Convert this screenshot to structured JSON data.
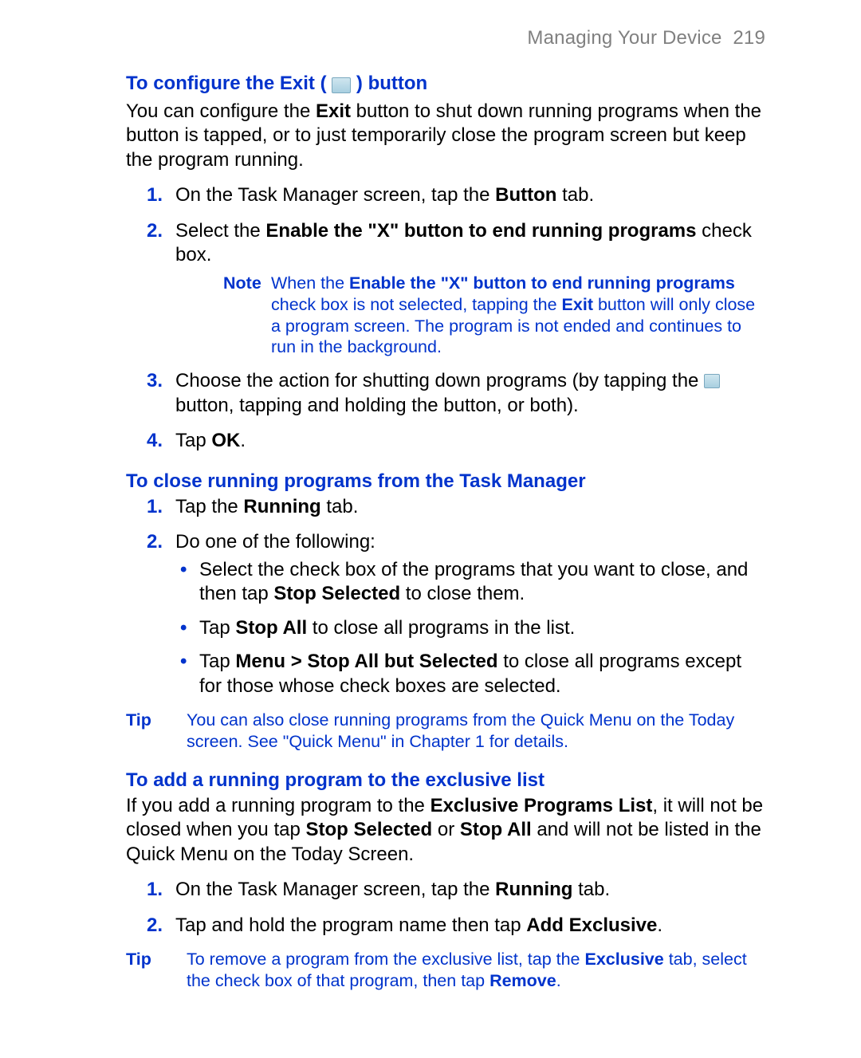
{
  "header": {
    "chapter": "Managing Your Device",
    "page_number": "219"
  },
  "sec1": {
    "title_a": "To configure the Exit (",
    "title_b": ") button",
    "intro_a": "You can configure the ",
    "intro_exit": "Exit",
    "intro_b": " button to shut down running programs when the button is tapped, or to just temporarily close the program screen but keep the program running.",
    "step1_a": "On the Task Manager screen, tap the ",
    "step1_button": "Button",
    "step1_b": " tab.",
    "step2_a": "Select the ",
    "step2_enable": "Enable the \"X\" button to end running programs",
    "step2_b": " check box.",
    "note_label": "Note",
    "note_a": "When the ",
    "note_enable": "Enable the \"X\" button to end running programs",
    "note_b": " check box is not selected, tapping the ",
    "note_exit": "Exit",
    "note_c": " button will only close a program screen. The program is not ended and continues to run in the background.",
    "step3_a": "Choose the action for shutting down programs (by tapping the ",
    "step3_b": " button, tapping and holding the button, or both).",
    "step4_a": "Tap ",
    "step4_ok": "OK",
    "step4_b": "."
  },
  "sec2": {
    "title": "To close running programs from the Task Manager",
    "step1_a": "Tap the ",
    "step1_running": "Running",
    "step1_b": " tab.",
    "step2": "Do one of the following:",
    "bul1_a": "Select the check box of the programs that you want to close, and then tap ",
    "bul1_stopsel": "Stop Selected",
    "bul1_b": " to close them.",
    "bul2_a": "Tap ",
    "bul2_stopall": "Stop All",
    "bul2_b": " to close all programs in the list.",
    "bul3_a": "Tap ",
    "bul3_menu": "Menu > Stop All but Selected",
    "bul3_b": " to close all programs except for those whose check boxes are selected.",
    "tip_label": "Tip",
    "tip_text": "You can also close running programs from the Quick Menu on the Today screen. See \"Quick Menu\" in Chapter 1 for details."
  },
  "sec3": {
    "title": "To add a running program to the exclusive list",
    "intro_a": "If you add a running program to the ",
    "intro_epl": "Exclusive Programs List",
    "intro_b": ", it will not be closed when you tap ",
    "intro_stopsel": "Stop Selected",
    "intro_c": " or ",
    "intro_stopall": "Stop All",
    "intro_d": " and will not be listed in the Quick Menu on the Today Screen.",
    "step1_a": "On the Task Manager screen, tap the ",
    "step1_running": "Running",
    "step1_b": " tab.",
    "step2_a": "Tap and hold the program name then tap ",
    "step2_add": "Add Exclusive",
    "step2_b": ".",
    "tip_label": "Tip",
    "tip_a": "To remove a program from the exclusive list, tap the ",
    "tip_excl": "Exclusive",
    "tip_b": " tab, select the check box of that program, then tap ",
    "tip_remove": "Remove",
    "tip_c": "."
  }
}
